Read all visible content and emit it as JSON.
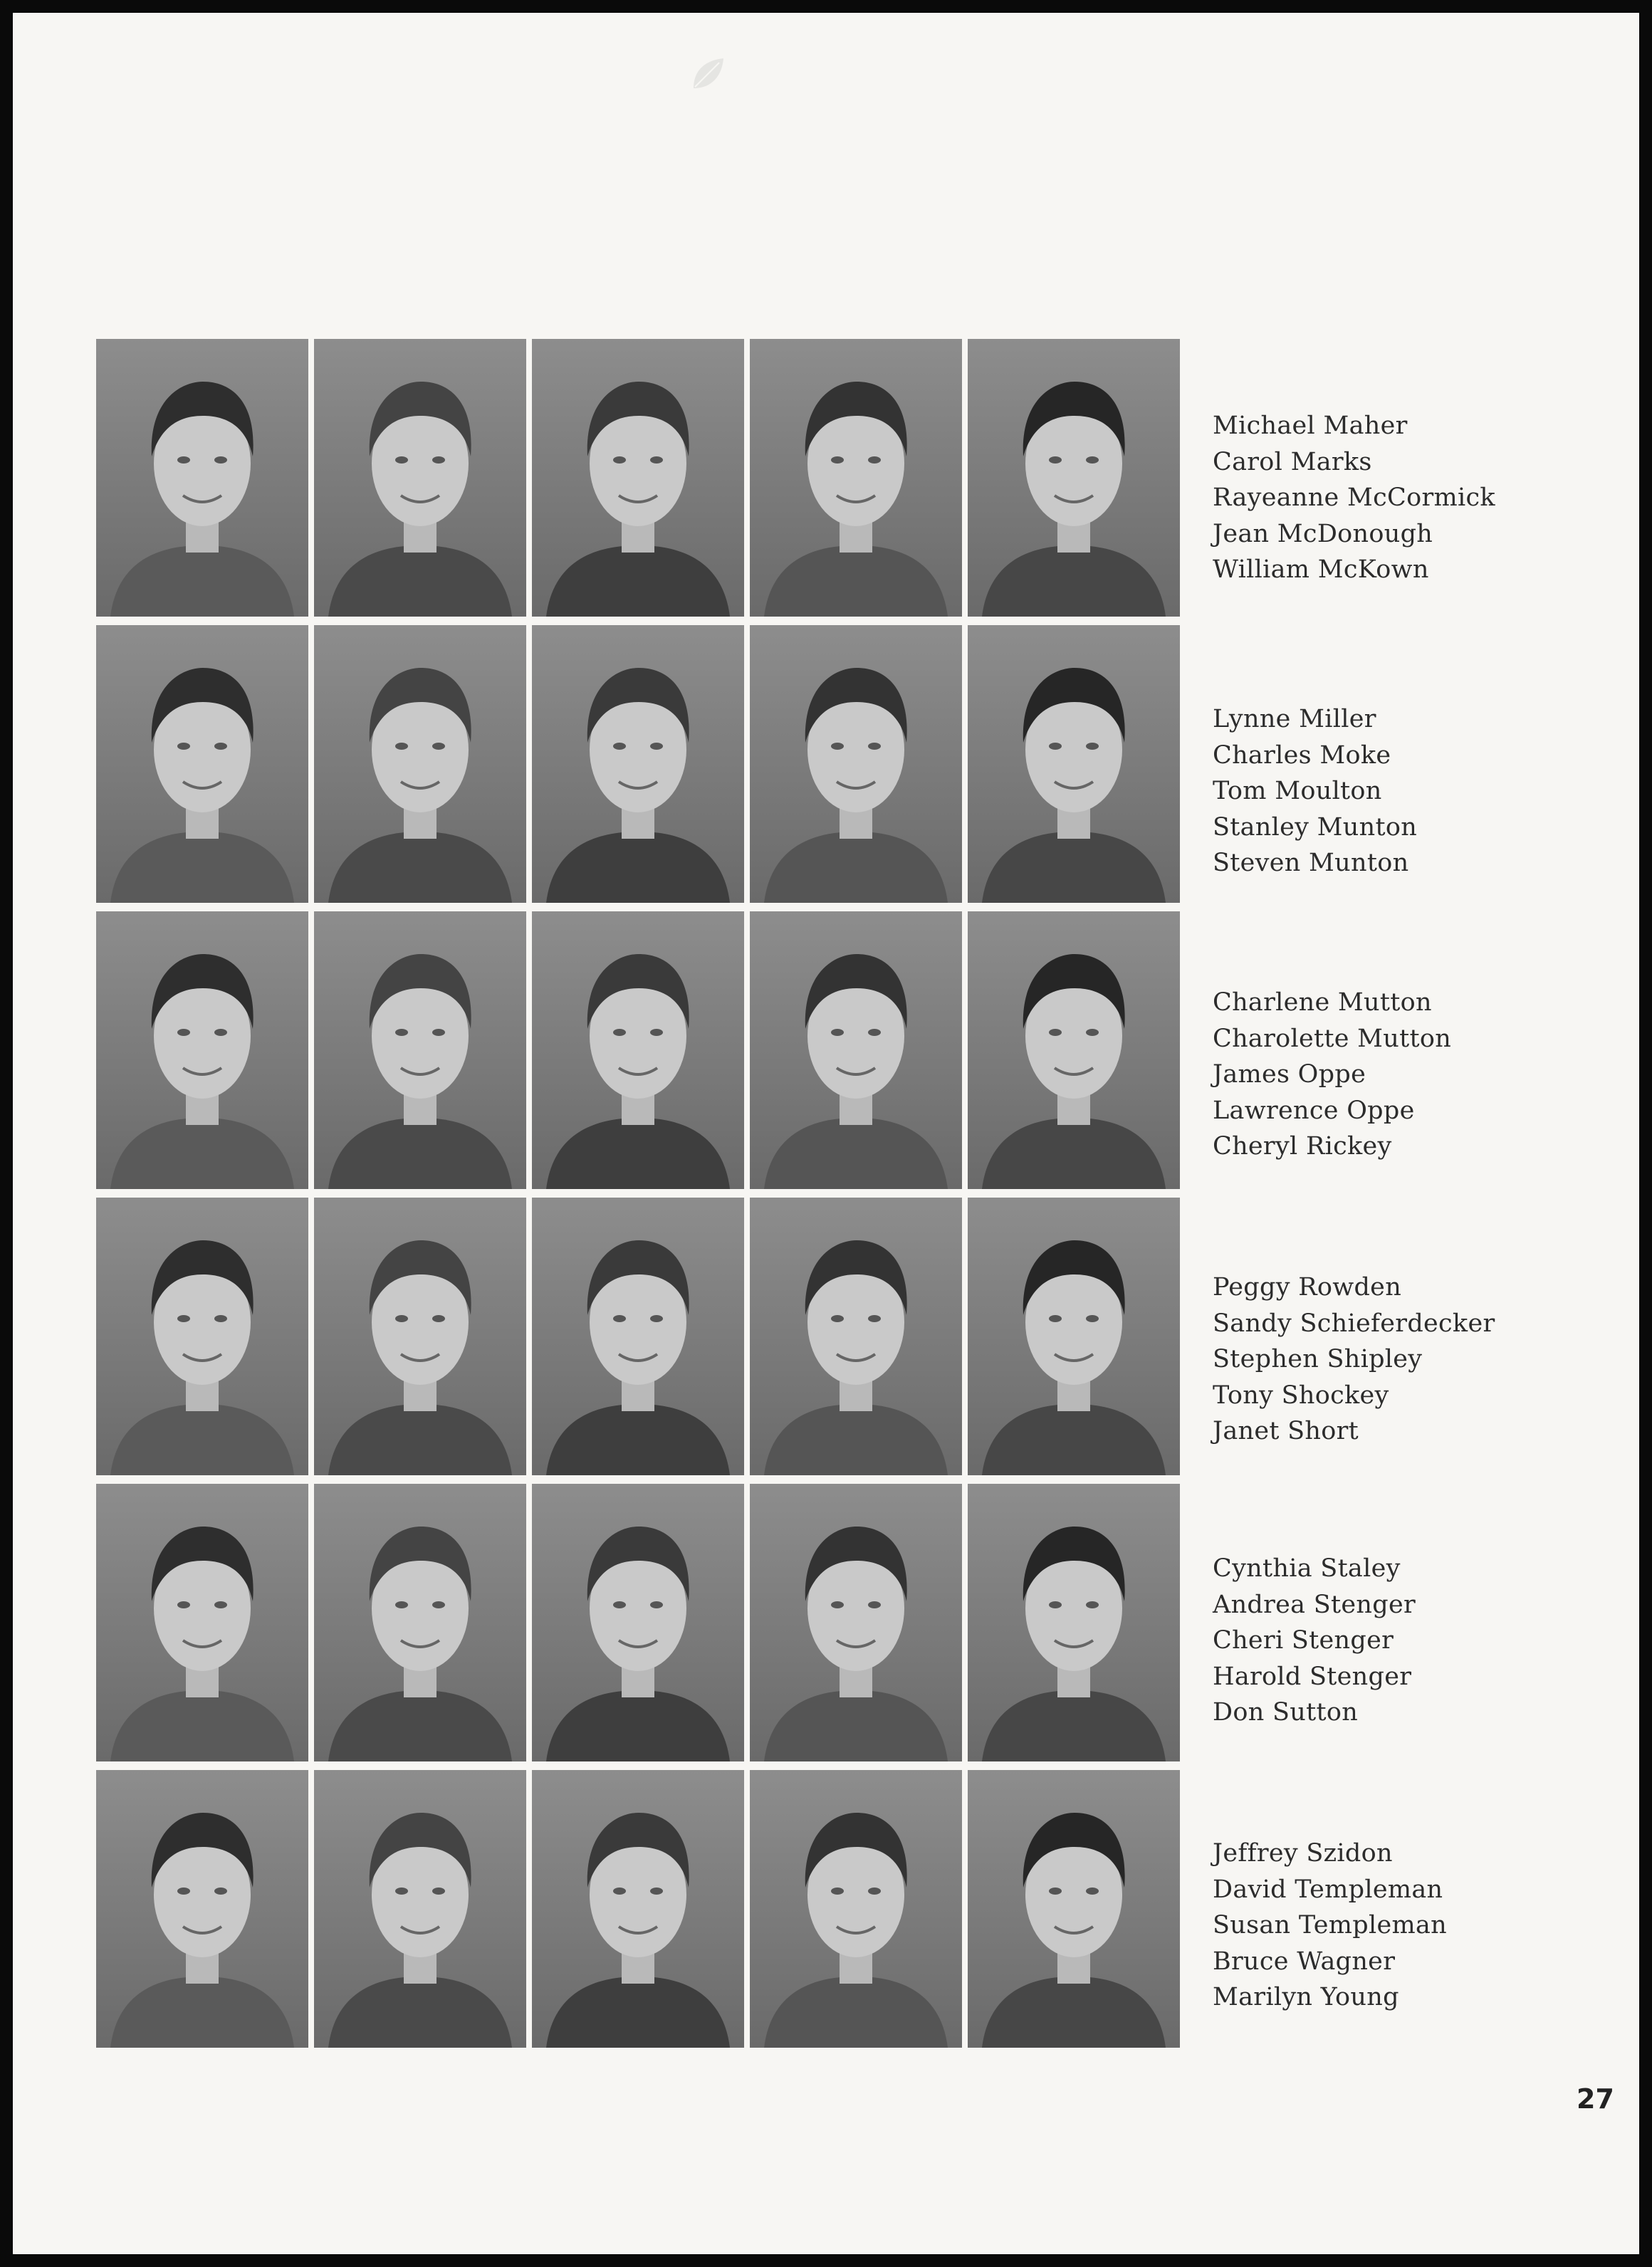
{
  "page_number": "27",
  "rows": [
    {
      "names": [
        "Michael Maher",
        "Carol Marks",
        "Rayeanne McCormick",
        "Jean McDonough",
        "William McKown"
      ]
    },
    {
      "names": [
        "Lynne Miller",
        "Charles Moke",
        "Tom Moulton",
        "Stanley Munton",
        "Steven Munton"
      ]
    },
    {
      "names": [
        "Charlene Mutton",
        "Charolette Mutton",
        "James Oppe",
        "Lawrence Oppe",
        "Cheryl Rickey"
      ]
    },
    {
      "names": [
        "Peggy Rowden",
        "Sandy Schieferdecker",
        "Stephen Shipley",
        "Tony Shockey",
        "Janet Short"
      ]
    },
    {
      "names": [
        "Cynthia Staley",
        "Andrea Stenger",
        "Cheri Stenger",
        "Harold Stenger",
        "Don Sutton"
      ]
    },
    {
      "names": [
        "Jeffrey Szidon",
        "David Templeman",
        "Susan Templeman",
        "Bruce Wagner",
        "Marilyn Young"
      ]
    }
  ]
}
